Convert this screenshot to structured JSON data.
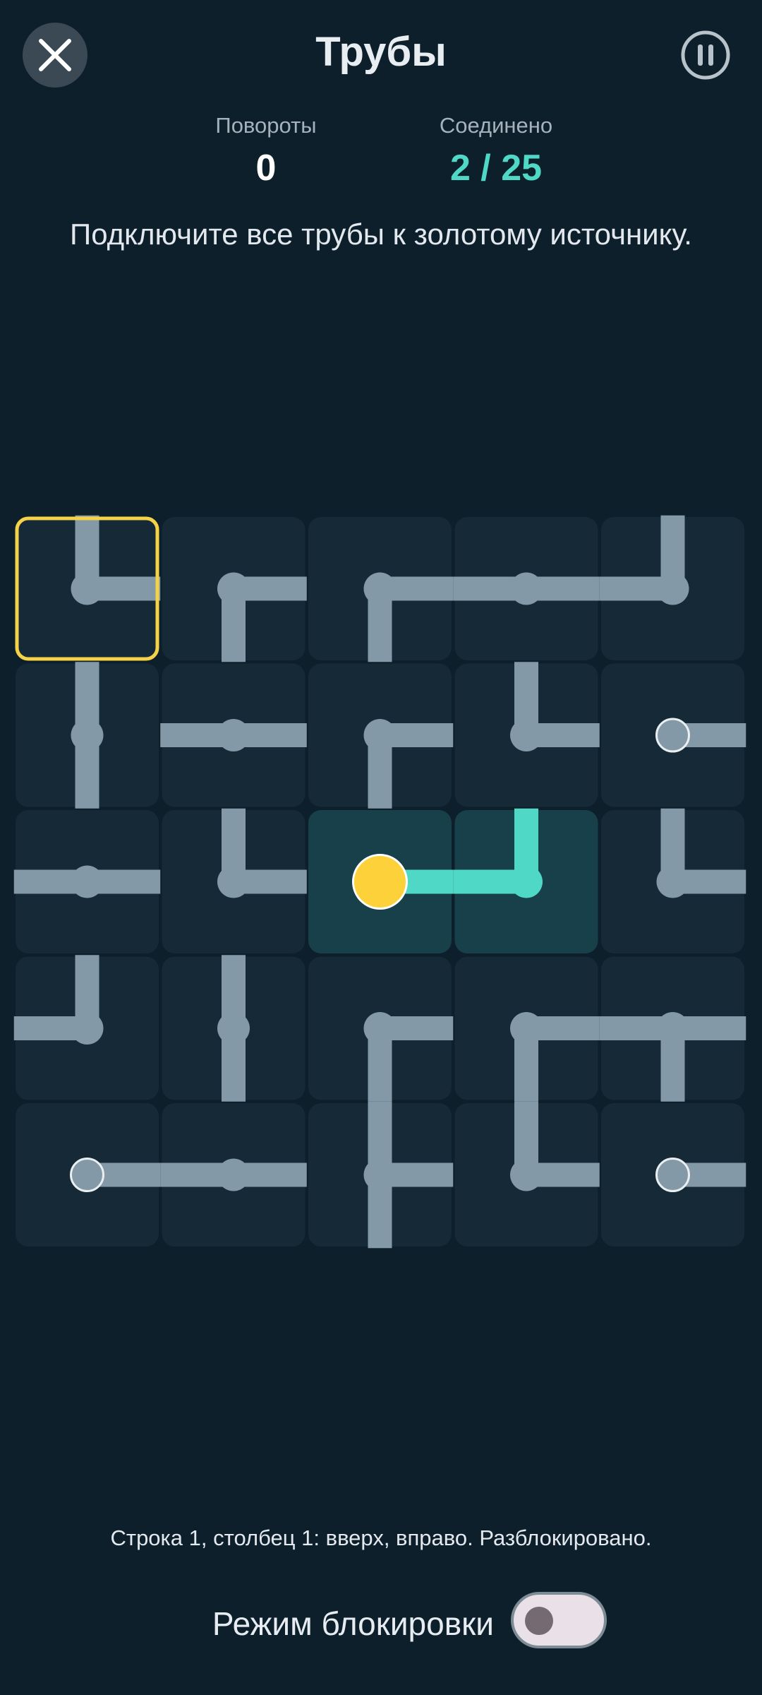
{
  "header": {
    "title": "Трубы",
    "close_icon": "close-icon",
    "pause_icon": "pause-icon"
  },
  "stats": {
    "turns_label": "Повороты",
    "turns_value": "0",
    "connected_label": "Соединено",
    "connected_value": "2 / 25"
  },
  "instruction": "Подключите все трубы к золотому источнику.",
  "colors": {
    "background": "#0d1f2a",
    "tile": "#152a36",
    "tile_connected": "#18404b",
    "pipe": "#8399a7",
    "pipe_connected": "#4fd8c6",
    "source": "#fdd13a",
    "selection": "#f5d247"
  },
  "grid": {
    "rows": 5,
    "cols": 5,
    "selected": [
      1,
      1
    ],
    "source": [
      3,
      3
    ],
    "cells": [
      [
        {
          "exits": [
            "up",
            "right"
          ],
          "terminal": false,
          "connected": false
        },
        {
          "exits": [
            "right",
            "down"
          ],
          "terminal": false,
          "connected": false
        },
        {
          "exits": [
            "right",
            "down"
          ],
          "terminal": false,
          "connected": false
        },
        {
          "exits": [
            "left",
            "right"
          ],
          "terminal": false,
          "connected": false
        },
        {
          "exits": [
            "up",
            "left"
          ],
          "terminal": false,
          "connected": false
        }
      ],
      [
        {
          "exits": [
            "up",
            "down"
          ],
          "terminal": false,
          "connected": false
        },
        {
          "exits": [
            "left",
            "right"
          ],
          "terminal": false,
          "connected": false
        },
        {
          "exits": [
            "right",
            "down"
          ],
          "terminal": false,
          "connected": false
        },
        {
          "exits": [
            "up",
            "right"
          ],
          "terminal": false,
          "connected": false
        },
        {
          "exits": [
            "right"
          ],
          "terminal": true,
          "connected": false
        }
      ],
      [
        {
          "exits": [
            "left",
            "right"
          ],
          "terminal": false,
          "connected": false
        },
        {
          "exits": [
            "up",
            "right"
          ],
          "terminal": false,
          "connected": false
        },
        {
          "exits": [
            "right"
          ],
          "terminal": false,
          "connected": true,
          "source": true
        },
        {
          "exits": [
            "up",
            "left"
          ],
          "terminal": false,
          "connected": true
        },
        {
          "exits": [
            "up",
            "right"
          ],
          "terminal": false,
          "connected": false
        }
      ],
      [
        {
          "exits": [
            "up",
            "left"
          ],
          "terminal": false,
          "connected": false
        },
        {
          "exits": [
            "up",
            "down"
          ],
          "terminal": false,
          "connected": false
        },
        {
          "exits": [
            "right",
            "down"
          ],
          "terminal": false,
          "connected": false
        },
        {
          "exits": [
            "right",
            "down"
          ],
          "terminal": false,
          "connected": false
        },
        {
          "exits": [
            "left",
            "right",
            "down"
          ],
          "terminal": false,
          "connected": false
        }
      ],
      [
        {
          "exits": [
            "right"
          ],
          "terminal": true,
          "connected": false
        },
        {
          "exits": [
            "left",
            "right"
          ],
          "terminal": false,
          "connected": false
        },
        {
          "exits": [
            "up",
            "right",
            "down"
          ],
          "terminal": false,
          "connected": false
        },
        {
          "exits": [
            "up",
            "right"
          ],
          "terminal": false,
          "connected": false
        },
        {
          "exits": [
            "right"
          ],
          "terminal": true,
          "connected": false
        }
      ]
    ]
  },
  "status_line": "Строка 1, столбец 1: вверх, вправо. Разблокировано.",
  "lock_mode": {
    "label": "Режим блокировки",
    "on": false
  }
}
